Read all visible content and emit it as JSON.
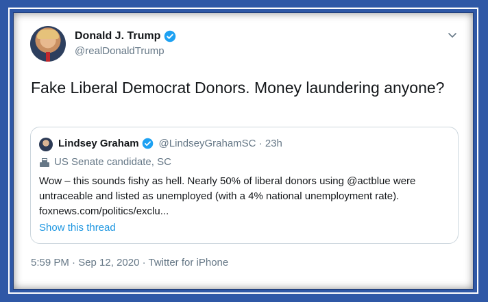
{
  "tweet": {
    "author_name": "Donald J. Trump",
    "author_handle": "@realDonaldTrump",
    "text": "Fake Liberal Democrat Donors. Money laundering anyone?",
    "footer": "5:59 PM · Sep 12, 2020 · Twitter for iPhone"
  },
  "quote": {
    "author_name": "Lindsey Graham",
    "meta": "@LindseyGrahamSC · 23h",
    "label": "US Senate candidate, SC",
    "body_line1": "Wow – this sounds fishy as hell. Nearly 50% of liberal donors using @actblue were",
    "body_line2": "untraceable and listed as unemployed (with a 4% national unemployment rate).",
    "body_line3": "foxnews.com/politics/exclu...",
    "thread_link": "Show this thread"
  },
  "colors": {
    "frame": "#2f58a6",
    "verified": "#1da1f2",
    "link": "#1b95e0",
    "muted": "#657786"
  },
  "icons": [
    "verified-badge-icon",
    "chevron-down-icon",
    "ballot-box-icon"
  ]
}
